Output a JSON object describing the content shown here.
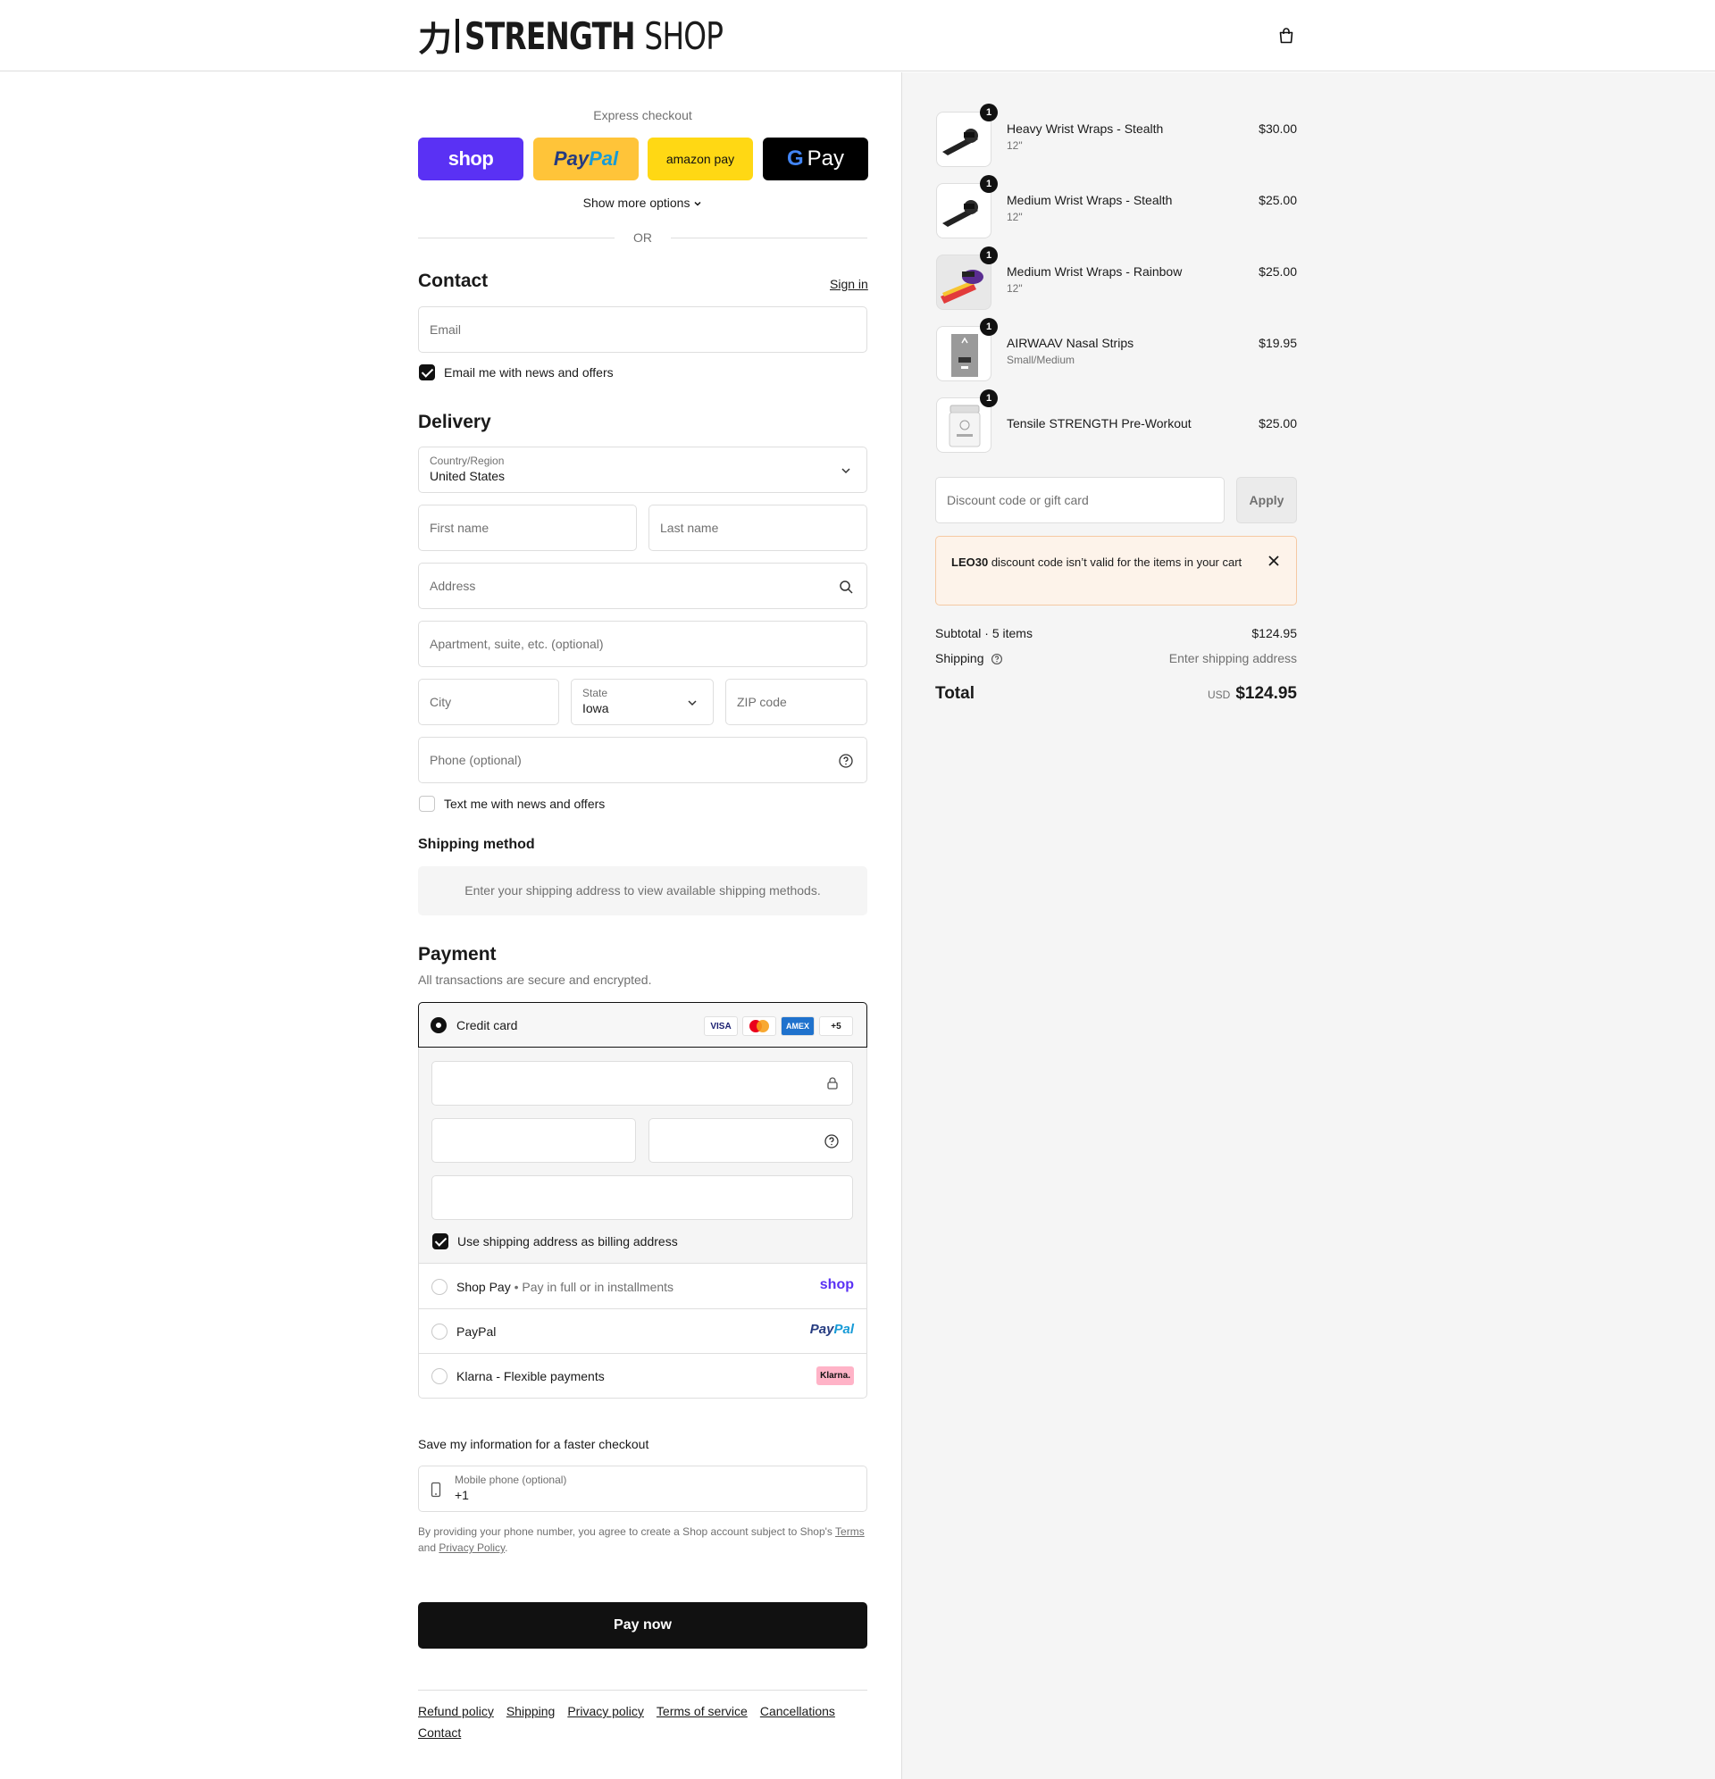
{
  "header": {
    "logo_kanji": "力",
    "logo_brand_bold": "STRENGTH",
    "logo_brand_light": "SHOP",
    "cart_icon": "shopping-bag-icon"
  },
  "express": {
    "label": "Express checkout",
    "shop_label": "shop",
    "paypal_pay": "Pay",
    "paypal_pal": "Pal",
    "amazon_label": "amazon pay",
    "gpay_g": "G",
    "gpay_label": "Pay",
    "more_options": "Show more options",
    "or": "OR"
  },
  "contact": {
    "heading": "Contact",
    "sign_in": "Sign in",
    "email_placeholder": "Email",
    "news_label": "Email me with news and offers",
    "news_checked": true
  },
  "delivery": {
    "heading": "Delivery",
    "country_label": "Country/Region",
    "country_value": "United States",
    "first_name": "First name",
    "last_name": "Last name",
    "address": "Address",
    "apartment": "Apartment, suite, etc. (optional)",
    "city": "City",
    "state_label": "State",
    "state_value": "Iowa",
    "zip": "ZIP code",
    "phone": "Phone (optional)",
    "text_label": "Text me with news and offers",
    "text_checked": false
  },
  "shipping_method": {
    "heading": "Shipping method",
    "message": "Enter your shipping address to view available shipping methods."
  },
  "payment": {
    "heading": "Payment",
    "subtitle": "All transactions are secure and encrypted.",
    "credit_card": "Credit card",
    "card_logos": [
      "VISA",
      "",
      "AMEX",
      "+5"
    ],
    "billing_label": "Use shipping address as billing address",
    "billing_checked": true,
    "shop_pay": "Shop Pay",
    "shop_pay_sub": "Pay in full or in installments",
    "shop_pay_mark": "shop",
    "paypal": "PayPal",
    "paypal_mark_a": "Pay",
    "paypal_mark_b": "Pal",
    "klarna": "Klarna - Flexible payments",
    "klarna_mark": "Klarna."
  },
  "save_info": {
    "heading": "Save my information for a faster checkout",
    "phone_label": "Mobile phone (optional)",
    "phone_value": "+1",
    "legal_prefix": "By providing your phone number, you agree to create a Shop account subject to Shop's",
    "terms": "Terms",
    "and": "and",
    "privacy": "Privacy Policy",
    "period": "."
  },
  "pay_now": "Pay now",
  "footer": [
    "Refund policy",
    "Shipping",
    "Privacy policy",
    "Terms of service",
    "Cancellations",
    "Contact"
  ],
  "summary": {
    "items": [
      {
        "qty": "1",
        "name": "Heavy Wrist Wraps - Stealth",
        "variant": "12\"",
        "price": "$30.00"
      },
      {
        "qty": "1",
        "name": "Medium Wrist Wraps - Stealth",
        "variant": "12\"",
        "price": "$25.00"
      },
      {
        "qty": "1",
        "name": "Medium Wrist Wraps - Rainbow",
        "variant": "12\"",
        "price": "$25.00"
      },
      {
        "qty": "1",
        "name": "AIRWAAV Nasal Strips",
        "variant": "Small/Medium",
        "price": "$19.95"
      },
      {
        "qty": "1",
        "name": "Tensile STRENGTH Pre-Workout",
        "variant": "",
        "price": "$25.00"
      }
    ],
    "discount_placeholder": "Discount code or gift card",
    "apply": "Apply",
    "alert_code": "LEO30",
    "alert_text": "discount code isn’t valid for the items in your cart",
    "subtotal_label": "Subtotal · 5 items",
    "subtotal_value": "$124.95",
    "shipping_label": "Shipping",
    "shipping_value": "Enter shipping address",
    "total_label": "Total",
    "currency": "USD",
    "total_value": "$124.95"
  }
}
